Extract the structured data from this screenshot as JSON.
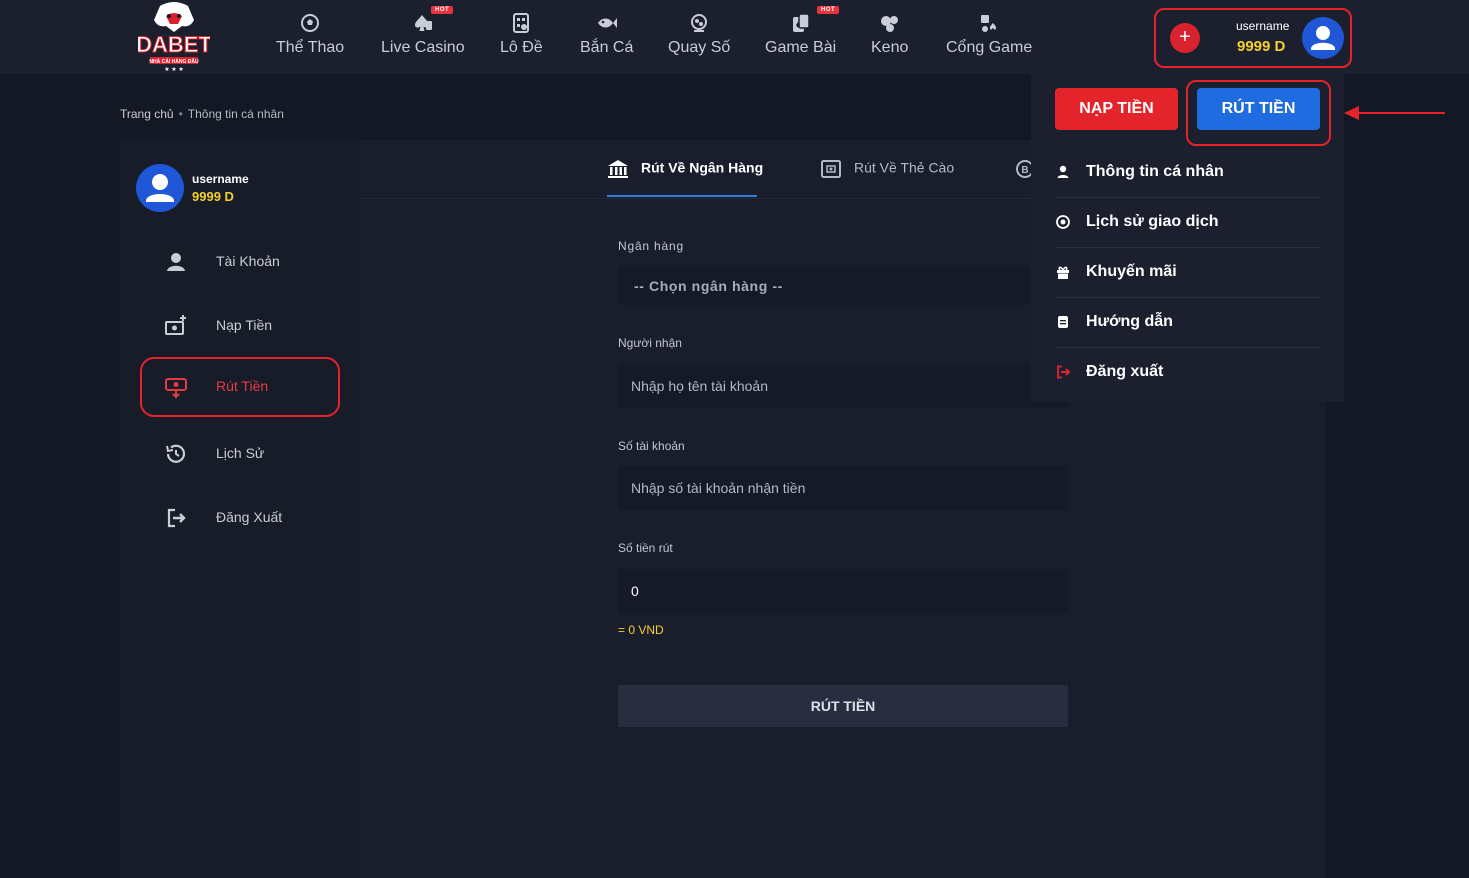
{
  "header": {
    "logo_text": "DABET",
    "logo_tagline": "NHÀ CÁI HÀNG ĐẦU",
    "nav": [
      {
        "label": "Thể Thao",
        "icon": "soccer-ball-icon",
        "hot": false
      },
      {
        "label": "Live Casino",
        "icon": "spade-card-icon",
        "hot": true
      },
      {
        "label": "Lô Đề",
        "icon": "lottery-ticket-icon",
        "hot": false
      },
      {
        "label": "Bắn Cá",
        "icon": "fish-icon",
        "hot": false
      },
      {
        "label": "Quay Số",
        "icon": "lottery-globe-icon",
        "hot": false
      },
      {
        "label": "Game Bài",
        "icon": "playing-cards-icon",
        "hot": true
      },
      {
        "label": "Keno",
        "icon": "keno-balls-icon",
        "hot": false
      },
      {
        "label": "Cổng Game",
        "icon": "game-portal-icon",
        "hot": false
      }
    ],
    "hot_label": "HOT",
    "user": {
      "username": "username",
      "balance": "9999 D"
    },
    "add_funds_symbol": "+"
  },
  "breadcrumb": {
    "home": "Trang chủ",
    "separator": "•",
    "current": "Thông tin cá nhân"
  },
  "sidebar": {
    "username": "username",
    "balance": "9999 D",
    "items": [
      {
        "label": "Tài Khoản",
        "icon": "user-icon"
      },
      {
        "label": "Nạp Tiền",
        "icon": "deposit-cash-icon"
      },
      {
        "label": "Rút Tiền",
        "icon": "withdraw-icon",
        "active": true
      },
      {
        "label": "Lịch Sử",
        "icon": "history-icon"
      },
      {
        "label": "Đăng Xuất",
        "icon": "logout-icon"
      }
    ]
  },
  "main": {
    "tabs": [
      {
        "label": "Rút Về Ngân Hàng",
        "icon": "bank-icon",
        "active": true
      },
      {
        "label": "Rút Về Thẻ Cào",
        "icon": "scratch-card-icon",
        "active": false
      }
    ],
    "form": {
      "bank_label": "Ngân hàng",
      "bank_placeholder": "-- Chọn ngân hàng --",
      "recipient_label": "Người nhận",
      "recipient_placeholder": "Nhập họ tên tài khoản",
      "account_label": "Số tài khoản",
      "account_placeholder": "Nhập số tài khoản nhận tiền",
      "amount_label": "Số tiền rút",
      "amount_value": "0",
      "amount_converted": "= 0 VND",
      "submit_label": "RÚT TIỀN"
    }
  },
  "dropdown": {
    "deposit_label": "NẠP TIỀN",
    "withdraw_label": "RÚT TIỀN",
    "items": [
      {
        "label": "Thông tin cá nhân",
        "icon": "user-icon"
      },
      {
        "label": "Lịch sử giao dịch",
        "icon": "transaction-history-icon"
      },
      {
        "label": "Khuyến mãi",
        "icon": "gift-icon"
      },
      {
        "label": "Hướng dẫn",
        "icon": "guide-book-icon"
      },
      {
        "label": "Đăng xuất",
        "icon": "logout-icon"
      }
    ]
  },
  "colors": {
    "accent_red": "#e3242b",
    "accent_blue": "#1f6be0",
    "balance_yellow": "#f5d130",
    "background": "#141824"
  }
}
